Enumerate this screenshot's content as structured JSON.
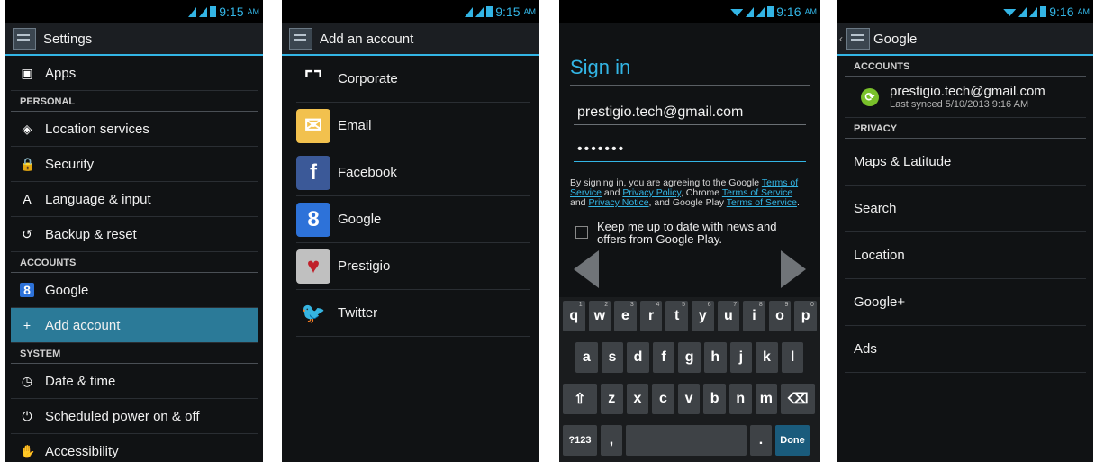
{
  "screen1": {
    "time": "9:15",
    "ampm": "AM",
    "title": "Settings",
    "rows": [
      {
        "kind": "row",
        "label": "Apps",
        "icon": "apps-icon",
        "glyph": "▣"
      },
      {
        "kind": "header",
        "label": "PERSONAL"
      },
      {
        "kind": "row",
        "label": "Location services",
        "icon": "location-icon",
        "glyph": "◈"
      },
      {
        "kind": "row",
        "label": "Security",
        "icon": "lock-icon",
        "glyph": "🔒"
      },
      {
        "kind": "row",
        "label": "Language & input",
        "icon": "keyboard-a-icon",
        "glyph": "A"
      },
      {
        "kind": "row",
        "label": "Backup & reset",
        "icon": "backup-icon",
        "glyph": "↺"
      },
      {
        "kind": "header",
        "label": "ACCOUNTS"
      },
      {
        "kind": "row",
        "label": "Google",
        "icon": "google-account-icon",
        "glyph": "8"
      },
      {
        "kind": "row",
        "label": "Add account",
        "icon": "plus-icon",
        "glyph": "+",
        "selected": true
      },
      {
        "kind": "header",
        "label": "SYSTEM"
      },
      {
        "kind": "row",
        "label": "Date & time",
        "icon": "clock-icon",
        "glyph": "◷"
      },
      {
        "kind": "row",
        "label": "Scheduled power on & off",
        "icon": "power-schedule-icon",
        "glyph": "⏻"
      },
      {
        "kind": "row",
        "label": "Accessibility",
        "icon": "accessibility-icon",
        "glyph": "✋"
      }
    ]
  },
  "screen2": {
    "time": "9:15",
    "ampm": "AM",
    "title": "Add an account",
    "accounts": [
      {
        "label": "Corporate",
        "icon": "corporate-icon",
        "glyph": "⌜⌝",
        "bg": "#101214",
        "fg": "#ffffff"
      },
      {
        "label": "Email",
        "icon": "email-icon",
        "glyph": "✉",
        "bg": "#f2c14e",
        "fg": "#ffffff"
      },
      {
        "label": "Facebook",
        "icon": "facebook-icon",
        "glyph": "f",
        "bg": "#3b5998",
        "fg": "#ffffff"
      },
      {
        "label": "Google",
        "icon": "google-icon",
        "glyph": "8",
        "bg": "#2d72d9",
        "fg": "#ffffff"
      },
      {
        "label": "Prestigio",
        "icon": "prestigio-icon",
        "glyph": "♥",
        "bg": "#c0c0c0",
        "fg": "#c0202a"
      },
      {
        "label": "Twitter",
        "icon": "twitter-icon",
        "glyph": "🐦",
        "bg": "#101214",
        "fg": "#29a9e1"
      }
    ]
  },
  "screen3": {
    "time": "9:16",
    "ampm": "AM",
    "title": "Sign in",
    "email": "prestigio.tech@gmail.com",
    "password_dots": "•••••••",
    "terms": {
      "t1": "By signing in, you are agreeing to the Google ",
      "l1": "Terms of Service",
      "t2": " and ",
      "l2": "Privacy Policy",
      "t3": ", Chrome ",
      "l3": "Terms of Service",
      "t4": " and ",
      "l4": "Privacy Notice",
      "t5": ", and Google Play ",
      "l5": "Terms of Service",
      "t6": "."
    },
    "checkbox_label": "Keep me up to date with news and offers from Google Play.",
    "keyboard": {
      "row1": [
        {
          "k": "q",
          "s": "1"
        },
        {
          "k": "w",
          "s": "2"
        },
        {
          "k": "e",
          "s": "3"
        },
        {
          "k": "r",
          "s": "4"
        },
        {
          "k": "t",
          "s": "5"
        },
        {
          "k": "y",
          "s": "6"
        },
        {
          "k": "u",
          "s": "7"
        },
        {
          "k": "i",
          "s": "8"
        },
        {
          "k": "o",
          "s": "9"
        },
        {
          "k": "p",
          "s": "0"
        }
      ],
      "row2": [
        "a",
        "s",
        "d",
        "f",
        "g",
        "h",
        "j",
        "k",
        "l"
      ],
      "row3": [
        "⇧",
        "z",
        "x",
        "c",
        "v",
        "b",
        "n",
        "m",
        "⌫"
      ],
      "row4": [
        "?123",
        ",",
        "",
        ".",
        "Done"
      ]
    }
  },
  "screen4": {
    "time": "9:16",
    "ampm": "AM",
    "title": "Google",
    "accounts_header": "ACCOUNTS",
    "account_email": "prestigio.tech@gmail.com",
    "account_sync": "Last synced 5/10/2013 9:16 AM",
    "privacy_header": "PRIVACY",
    "items": [
      "Maps & Latitude",
      "Search",
      "Location",
      "Google+",
      "Ads"
    ]
  },
  "colors": {
    "accent": "#33b5e5",
    "selected": "#2b7a98",
    "background": "#101214"
  }
}
